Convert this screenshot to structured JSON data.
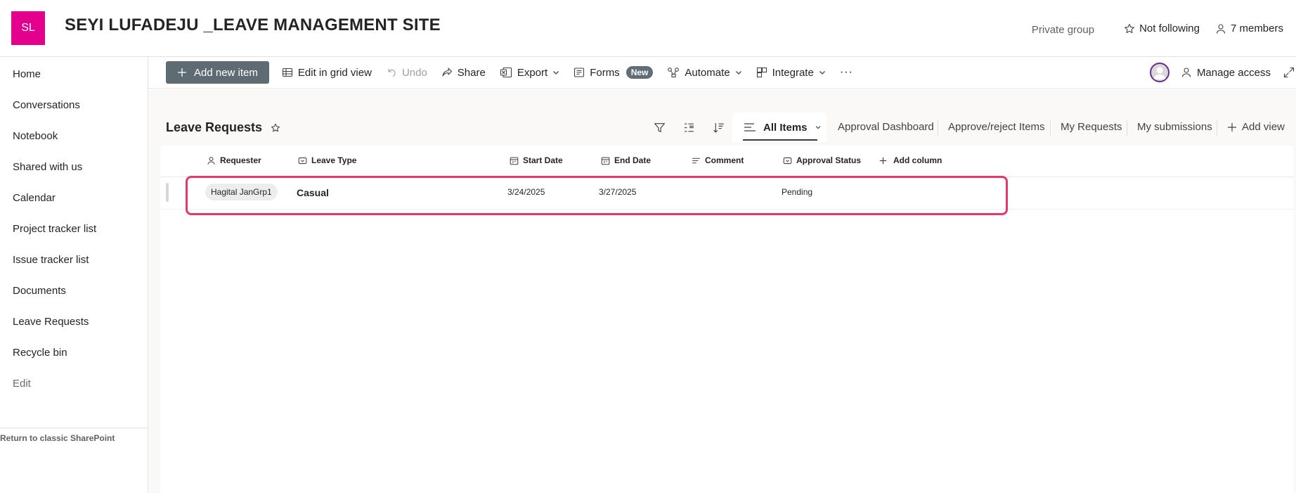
{
  "site": {
    "logo_initials": "SL",
    "title": "SEYI LUFADEJU _LEAVE MANAGEMENT SITE",
    "privacy": "Private group",
    "follow_label": "Not following",
    "members_label": "7 members",
    "brand_color": "#e3008c"
  },
  "nav": {
    "items": [
      {
        "label": "Home"
      },
      {
        "label": "Conversations"
      },
      {
        "label": "Notebook"
      },
      {
        "label": "Shared with us"
      },
      {
        "label": "Calendar"
      },
      {
        "label": "Project tracker list"
      },
      {
        "label": "Issue tracker list"
      },
      {
        "label": "Documents"
      },
      {
        "label": "Leave Requests"
      },
      {
        "label": "Recycle bin"
      }
    ],
    "edit_label": "Edit",
    "classic_link": "Return to classic SharePoint"
  },
  "toolbar": {
    "add_new_item": "Add new item",
    "edit_grid": "Edit in grid view",
    "undo": "Undo",
    "share": "Share",
    "export": "Export",
    "forms": "Forms",
    "forms_badge": "New",
    "automate": "Automate",
    "integrate": "Integrate",
    "more": "···",
    "manage_access": "Manage access"
  },
  "list": {
    "title": "Leave Requests",
    "views": {
      "active": "All Items",
      "others": [
        "Approval Dashboard",
        "Approve/reject Items",
        "My Requests",
        "My submissions"
      ],
      "add_view": "Add view"
    },
    "columns": {
      "requester": "Requester",
      "leave_type": "Leave Type",
      "start_date": "Start Date",
      "end_date": "End Date",
      "comment": "Comment",
      "approval_status": "Approval Status",
      "add_column": "Add column"
    },
    "rows": [
      {
        "requester": "Hagital JanGrp1",
        "leave_type": "Casual",
        "start_date": "3/24/2025",
        "end_date": "3/27/2025",
        "comment": "",
        "approval_status": "Pending"
      }
    ],
    "highlight_color": "#e6386a"
  }
}
